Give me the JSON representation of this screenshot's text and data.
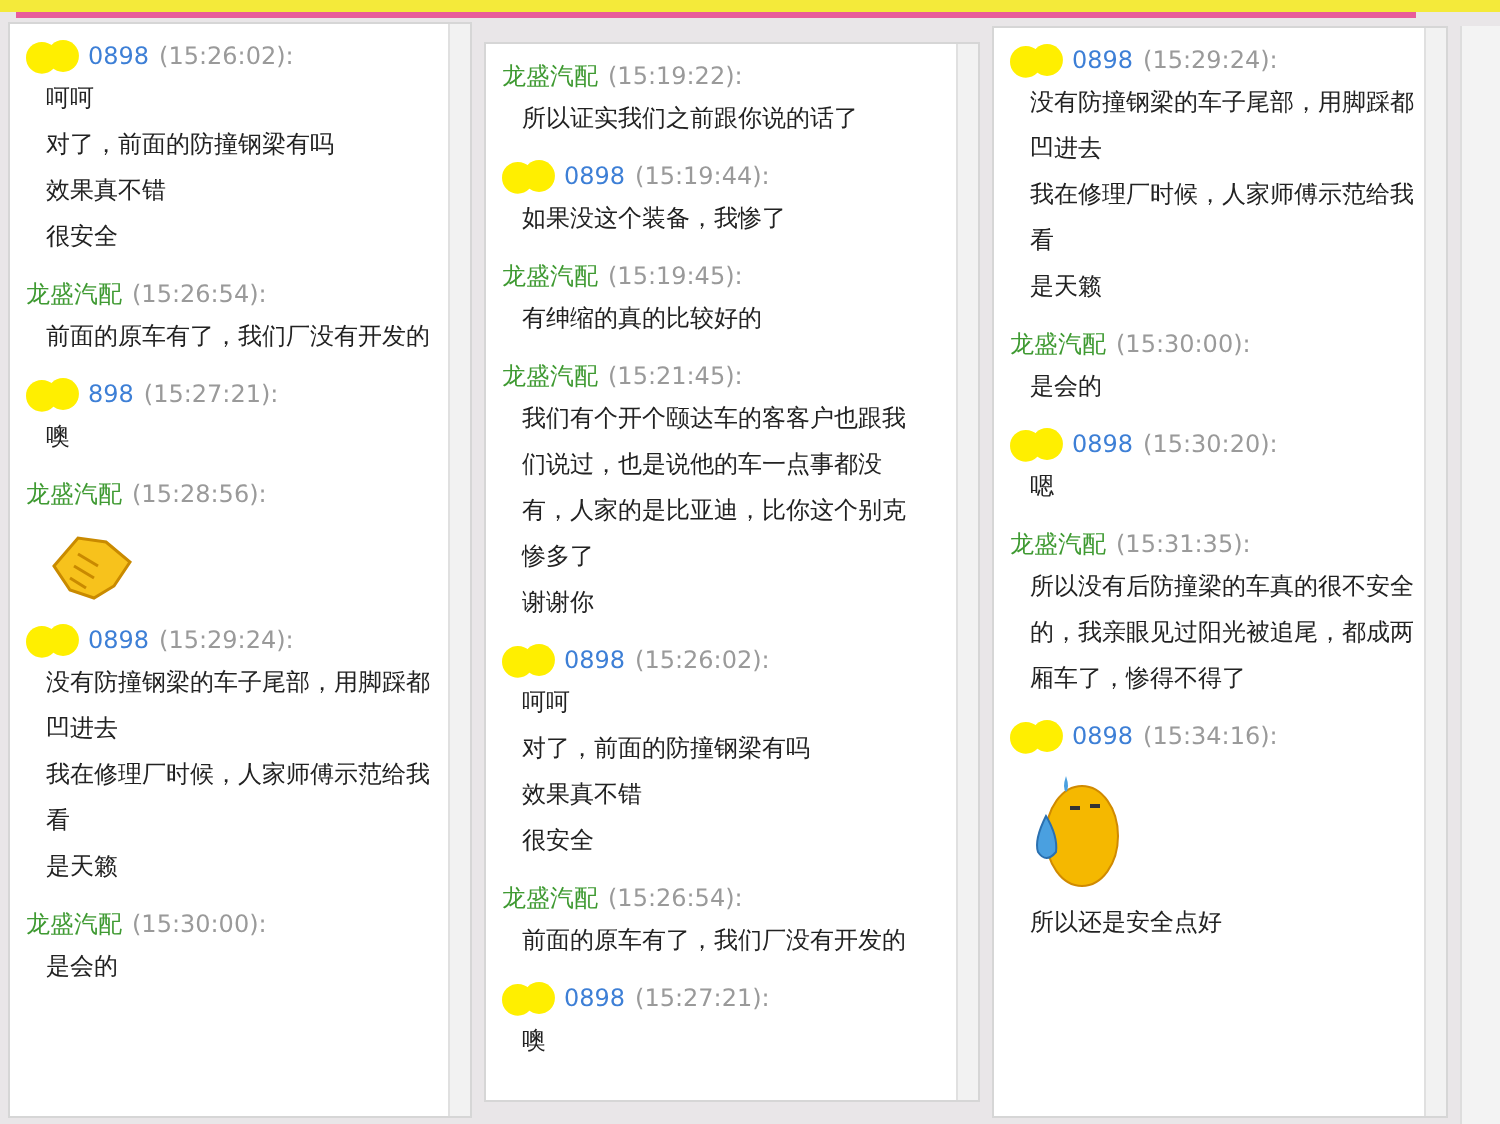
{
  "panels": [
    {
      "messages": [
        {
          "kind": "customer",
          "name": "0898",
          "time": "(15:26:02):",
          "items": [
            {
              "kind": "text",
              "text": "呵呵"
            },
            {
              "kind": "text",
              "text": "对了，前面的防撞钢梁有吗"
            },
            {
              "kind": "text",
              "text": "效果真不错"
            },
            {
              "kind": "text",
              "text": "很安全"
            }
          ]
        },
        {
          "kind": "shop",
          "name": "龙盛汽配",
          "time": "(15:26:54):",
          "items": [
            {
              "kind": "text",
              "text": "前面的原车有了，我们厂没有开发的"
            }
          ]
        },
        {
          "kind": "customer",
          "name": "898",
          "time": "(15:27:21):",
          "items": [
            {
              "kind": "text",
              "text": "噢"
            }
          ]
        },
        {
          "kind": "shop",
          "name": "龙盛汽配",
          "time": "(15:28:56):",
          "items": [
            {
              "kind": "handshake"
            }
          ]
        },
        {
          "kind": "customer",
          "name": "0898",
          "time": "(15:29:24):",
          "items": [
            {
              "kind": "text",
              "text": "没有防撞钢梁的车子尾部，用脚踩都凹进去"
            },
            {
              "kind": "text",
              "text": "我在修理厂时候，人家师傅示范给我看"
            },
            {
              "kind": "text",
              "text": "是天籁"
            }
          ]
        },
        {
          "kind": "shop",
          "name": "龙盛汽配",
          "time": "(15:30:00):",
          "items": [
            {
              "kind": "text",
              "text": "是会的"
            }
          ]
        }
      ]
    },
    {
      "messages": [
        {
          "kind": "shop",
          "name": "龙盛汽配",
          "time": "(15:19:22):",
          "items": [
            {
              "kind": "text",
              "text": "所以证实我们之前跟你说的话了"
            }
          ]
        },
        {
          "kind": "customer",
          "name": "0898",
          "time": "(15:19:44):",
          "items": [
            {
              "kind": "text",
              "text": "如果没这个装备，我惨了"
            }
          ]
        },
        {
          "kind": "shop",
          "name": "龙盛汽配",
          "time": "(15:19:45):",
          "items": [
            {
              "kind": "text",
              "text": "有绅缩的真的比较好的"
            }
          ]
        },
        {
          "kind": "shop",
          "name": "龙盛汽配",
          "time": "(15:21:45):",
          "items": [
            {
              "kind": "text",
              "text": "我们有个开个颐达车的客客户也跟我们说过，也是说他的车一点事都没有，人家的是比亚迪，比你这个别克惨多了"
            },
            {
              "kind": "text",
              "text": "谢谢你"
            }
          ]
        },
        {
          "kind": "customer",
          "name": "0898",
          "time": "(15:26:02):",
          "items": [
            {
              "kind": "text",
              "text": "呵呵"
            },
            {
              "kind": "text",
              "text": "对了，前面的防撞钢梁有吗"
            },
            {
              "kind": "text",
              "text": "效果真不错"
            },
            {
              "kind": "text",
              "text": "很安全"
            }
          ]
        },
        {
          "kind": "shop",
          "name": "龙盛汽配",
          "time": "(15:26:54):",
          "items": [
            {
              "kind": "text",
              "text": "前面的原车有了，我们厂没有开发的"
            }
          ]
        },
        {
          "kind": "customer",
          "name": "0898",
          "time": "(15:27:21):",
          "items": [
            {
              "kind": "text",
              "text": "噢"
            }
          ]
        }
      ]
    },
    {
      "messages": [
        {
          "kind": "customer",
          "name": "0898",
          "time": "(15:29:24):",
          "items": [
            {
              "kind": "text",
              "text": "没有防撞钢梁的车子尾部，用脚踩都凹进去"
            },
            {
              "kind": "text",
              "text": "我在修理厂时候，人家师傅示范给我看"
            },
            {
              "kind": "text",
              "text": "是天籁"
            }
          ]
        },
        {
          "kind": "shop",
          "name": "龙盛汽配",
          "time": "(15:30:00):",
          "items": [
            {
              "kind": "text",
              "text": "是会的"
            }
          ]
        },
        {
          "kind": "customer",
          "name": "0898",
          "time": "(15:30:20):",
          "items": [
            {
              "kind": "text",
              "text": "嗯"
            }
          ]
        },
        {
          "kind": "shop",
          "name": "龙盛汽配",
          "time": "(15:31:35):",
          "items": [
            {
              "kind": "text",
              "text": "所以没有后防撞梁的车真的很不安全的，我亲眼见过阳光被追尾，都成两厢车了，惨得不得了"
            }
          ]
        },
        {
          "kind": "customer",
          "name": "0898",
          "time": "(15:34:16):",
          "items": [
            {
              "kind": "sweat"
            },
            {
              "kind": "text",
              "text": "所以还是安全点好"
            }
          ]
        }
      ]
    }
  ]
}
